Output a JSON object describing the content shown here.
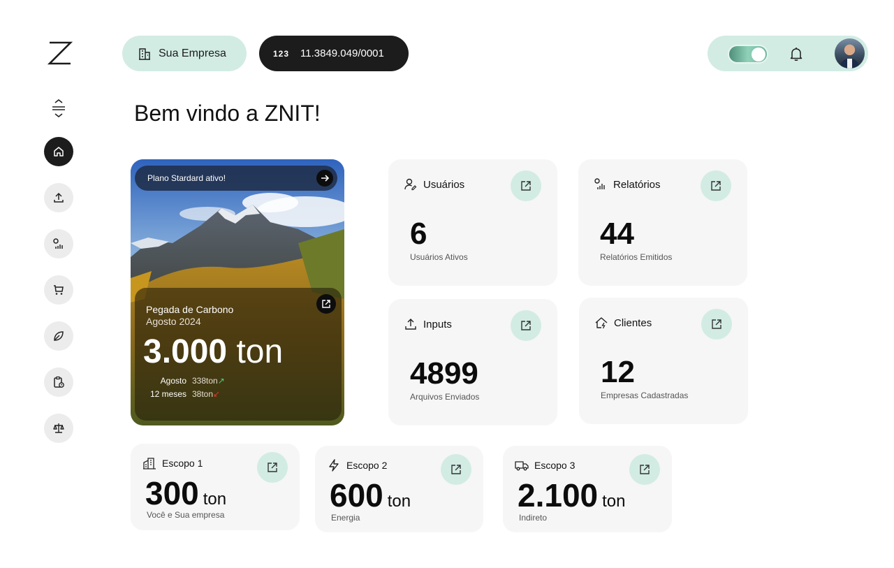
{
  "brand": {
    "logo_letter": "Z"
  },
  "topbar": {
    "company": "Sua Empresa",
    "cnpj_icon": "123",
    "cnpj": "11.3849.049/0001"
  },
  "welcome": "Bem vindo a ZNIT!",
  "sidebar": {
    "items": [
      {
        "icon": "home-icon",
        "active": true
      },
      {
        "icon": "upload-icon"
      },
      {
        "icon": "report-chart-icon"
      },
      {
        "icon": "cart-icon"
      },
      {
        "icon": "leaf-icon"
      },
      {
        "icon": "clipboard-clock-icon"
      },
      {
        "icon": "scale-icon"
      }
    ]
  },
  "hero": {
    "plan": "Plano Stardard ativo!",
    "title": "Pegada de Carbono",
    "period": "Agosto 2024",
    "value": "3.000",
    "unit": "ton",
    "rows": [
      {
        "label": "Agosto",
        "value": "338ton",
        "trend": "up"
      },
      {
        "label": "12 meses",
        "value": "38ton",
        "trend": "down"
      }
    ]
  },
  "cards": {
    "usuarios": {
      "title": "Usuários",
      "value": "6",
      "sub": "Usuários Ativos"
    },
    "relatorios": {
      "title": "Relatórios",
      "value": "44",
      "sub": "Relatórios Emitidos"
    },
    "inputs": {
      "title": "Inputs",
      "value": "4899",
      "sub": "Arquivos Enviados"
    },
    "clientes": {
      "title": "Clientes",
      "value": "12",
      "sub": "Empresas Cadastradas"
    }
  },
  "scopes": [
    {
      "title": "Escopo 1",
      "value": "300",
      "unit": "ton",
      "sub": "Você e Sua empresa"
    },
    {
      "title": "Escopo 2",
      "value": "600",
      "unit": "ton",
      "sub": "Energia"
    },
    {
      "title": "Escopo 3",
      "value": "2.100",
      "unit": "ton",
      "sub": "Indireto"
    }
  ],
  "colors": {
    "accent": "#d2ece4",
    "dark": "#1c1c1c",
    "card": "#f6f6f6",
    "trend_up": "#4ccf7a",
    "trend_down": "#e33b2b"
  }
}
